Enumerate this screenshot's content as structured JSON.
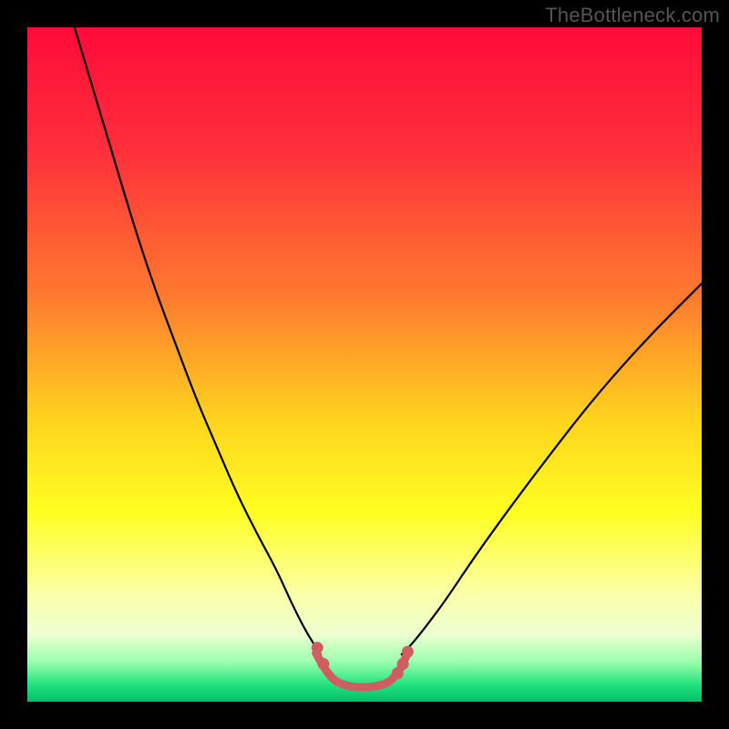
{
  "watermark": "TheBottleneck.com",
  "chart_data": {
    "type": "line",
    "title": "",
    "xlabel": "",
    "ylabel": "",
    "xlim": [
      0,
      100
    ],
    "ylim": [
      0,
      100
    ],
    "gradient_stops": [
      {
        "offset": 0.0,
        "color": "#ff0b3a"
      },
      {
        "offset": 0.18,
        "color": "#ff2f3b"
      },
      {
        "offset": 0.4,
        "color": "#ff7a2f"
      },
      {
        "offset": 0.58,
        "color": "#ffd21e"
      },
      {
        "offset": 0.72,
        "color": "#ffff22"
      },
      {
        "offset": 0.84,
        "color": "#fbffa8"
      },
      {
        "offset": 0.9,
        "color": "#edffd0"
      },
      {
        "offset": 0.94,
        "color": "#9effae"
      },
      {
        "offset": 0.975,
        "color": "#22e27f"
      },
      {
        "offset": 1.0,
        "color": "#00c066"
      }
    ],
    "series": [
      {
        "name": "left-curve",
        "stroke": "#000000",
        "width": 2.2,
        "x": [
          7,
          10,
          13,
          16,
          19,
          22,
          25,
          28,
          31,
          34,
          37,
          39,
          41,
          42.5,
          43.5
        ],
        "y": [
          100,
          90,
          80,
          70,
          61,
          53,
          45,
          38,
          31,
          25,
          19.5,
          15,
          11,
          8.5,
          7
        ]
      },
      {
        "name": "right-curve",
        "stroke": "#000000",
        "width": 2.2,
        "x": [
          55.5,
          57,
          59,
          62,
          66,
          71,
          77,
          84,
          92,
          100
        ],
        "y": [
          7,
          8.5,
          11,
          15,
          21,
          28,
          36,
          45,
          54,
          62
        ]
      },
      {
        "name": "valley-overlay",
        "stroke": "#cf5d61",
        "width": 9,
        "x": [
          42.8,
          43.8,
          44.8,
          46.0,
          48.0,
          50.0,
          52.0,
          53.5,
          54.6,
          55.4,
          56.2
        ],
        "y": [
          7.2,
          5.4,
          3.9,
          2.8,
          2.2,
          2.1,
          2.3,
          2.8,
          3.8,
          5.0,
          6.8
        ]
      }
    ],
    "markers": {
      "name": "valley-dots",
      "fill": "#cf5d61",
      "r": 6.5,
      "points": [
        {
          "x": 43.0,
          "y": 8.0
        },
        {
          "x": 43.9,
          "y": 5.6
        },
        {
          "x": 54.9,
          "y": 4.2
        },
        {
          "x": 55.7,
          "y": 5.6
        },
        {
          "x": 56.4,
          "y": 7.4
        }
      ]
    }
  }
}
